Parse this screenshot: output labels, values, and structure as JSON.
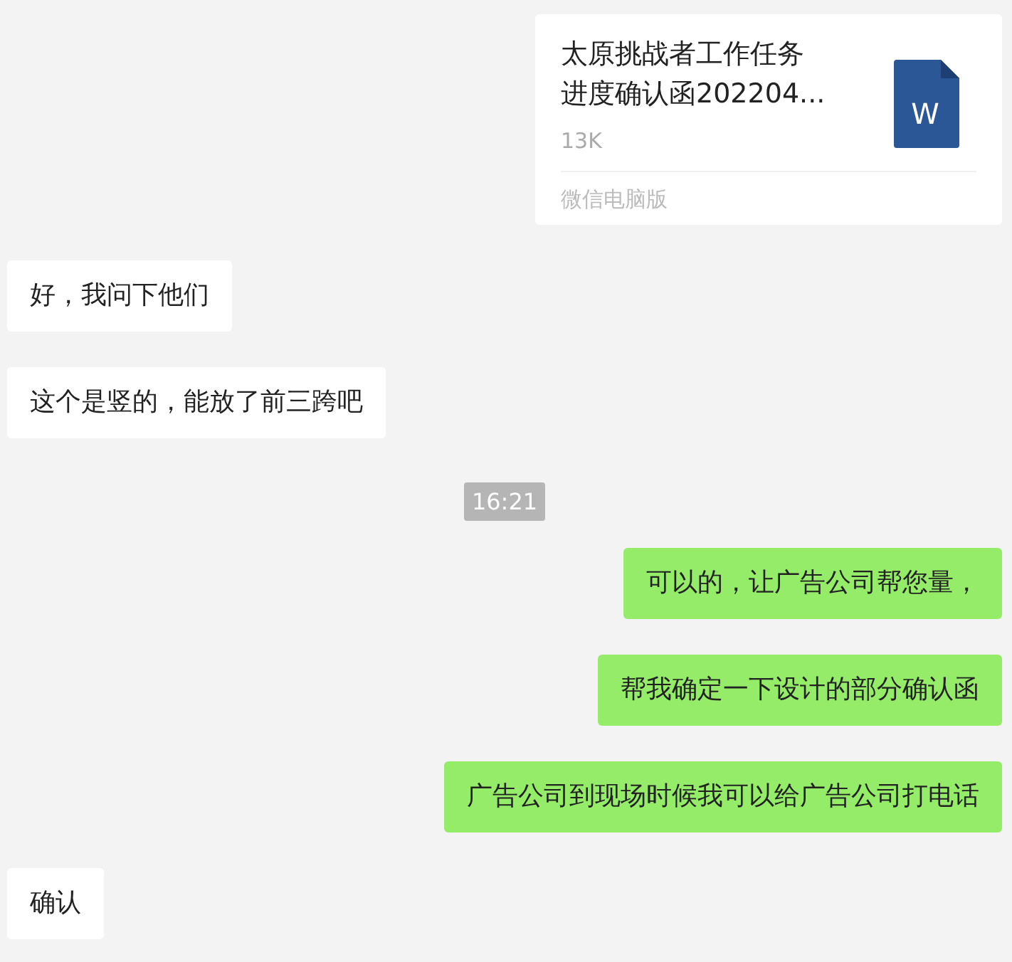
{
  "messages": [
    {
      "kind": "file",
      "outgoing": true,
      "title_lines": [
        "太原挑战者工作任务",
        "进度确认函202204..."
      ],
      "size": "13K",
      "source": "微信电脑版",
      "icon_letter": "W"
    },
    {
      "kind": "text",
      "outgoing": false,
      "text": "好，我问下他们"
    },
    {
      "kind": "text",
      "outgoing": false,
      "text": "这个是竖的，能放了前三跨吧"
    },
    {
      "kind": "time",
      "text": "16:21"
    },
    {
      "kind": "text",
      "outgoing": true,
      "text": "可以的，让广告公司帮您量，"
    },
    {
      "kind": "text",
      "outgoing": true,
      "text": "帮我确定一下设计的部分确认函"
    },
    {
      "kind": "text",
      "outgoing": true,
      "text": "广告公司到现场时候我可以给广告公司打电话"
    },
    {
      "kind": "text",
      "outgoing": false,
      "text": "确认"
    }
  ]
}
